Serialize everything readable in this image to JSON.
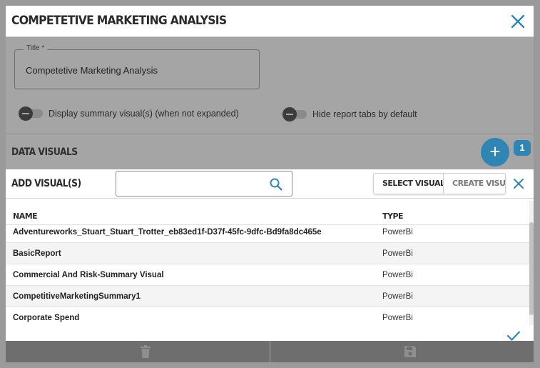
{
  "dialog": {
    "title": "COMPETETIVE MARKETING ANALYSIS"
  },
  "form": {
    "title_label": "Title",
    "title_required_mark": "*",
    "title_value": "Competetive Marketing Analysis",
    "toggle_summary_label": "Display summary visual(s) (when not expanded)",
    "toggle_summary_on": false,
    "toggle_tabs_label": "Hide report tabs by default",
    "toggle_tabs_on": false
  },
  "data_visuals": {
    "section_label": "DATA VISUALS",
    "add_button_label": "+",
    "count_badge": "1"
  },
  "add_panel": {
    "title": "ADD VISUAL(S)",
    "search_value": "",
    "tab_select": "SELECT VISUAL(S)",
    "tab_create": "CREATE VISUAL",
    "active_tab": "SELECT VISUAL(S)",
    "columns": {
      "name": "NAME",
      "type": "TYPE"
    },
    "rows": [
      {
        "name": "Adventureworks_Stuart_Stuart_Trotter_eb83ed1f-D37f-45fc-9dfc-Bd9fa8dc465e",
        "type": "PowerBi"
      },
      {
        "name": "BasicReport",
        "type": "PowerBi"
      },
      {
        "name": "Commercial And Risk-Summary Visual",
        "type": "PowerBi"
      },
      {
        "name": "CompetitiveMarketingSummary1",
        "type": "PowerBi"
      },
      {
        "name": "Corporate Spend",
        "type": "PowerBi"
      }
    ]
  },
  "colors": {
    "accent": "#2f86b5",
    "overlay": "#a5a5a5",
    "footer": "#6e6e6e"
  },
  "icons": {
    "close": "close-icon",
    "search": "search-icon",
    "confirm": "checkmark-icon",
    "delete": "trash-icon",
    "save": "floppy-disk-icon"
  }
}
